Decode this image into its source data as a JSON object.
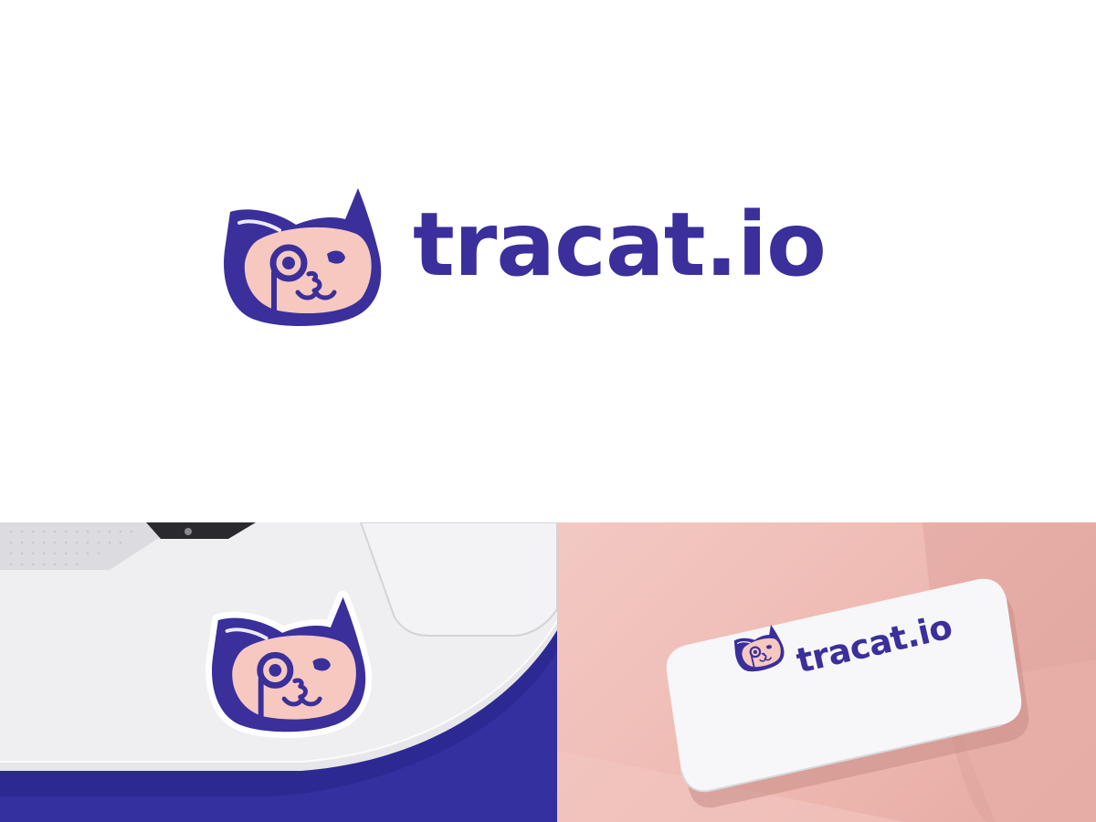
{
  "brand": {
    "name": "tracat.io",
    "colors": {
      "primary": "#3a2f9b",
      "face": "#f6c8c0",
      "background": "#ffffff",
      "laptop_surface": "#3430a0",
      "card_background": "#f1c2bb",
      "card": "#f7f7f9"
    }
  },
  "hero": {
    "mark_icon": "cat-monocle-icon",
    "wordmark": "tracat.io"
  },
  "mockups": {
    "laptop": {
      "sticker_icon": "cat-monocle-icon"
    },
    "card": {
      "mark_icon": "cat-monocle-icon",
      "wordmark": "tracat.io"
    }
  }
}
